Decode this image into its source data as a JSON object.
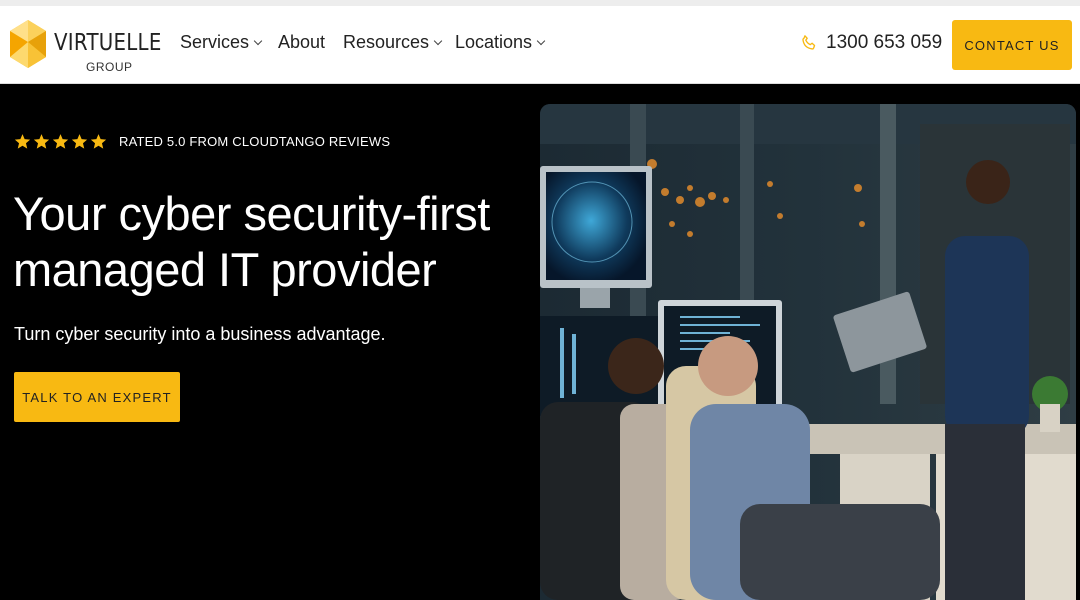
{
  "logo": {
    "name": "VIRTUELLE",
    "sub": "GROUP",
    "mark_color": "#f8b912"
  },
  "nav": {
    "items": [
      {
        "label": "Services",
        "dropdown": true
      },
      {
        "label": "About",
        "dropdown": false
      },
      {
        "label": "Resources",
        "dropdown": true
      },
      {
        "label": "Locations",
        "dropdown": true
      }
    ]
  },
  "header": {
    "phone": "1300 653 059",
    "contact_label": "CONTACT US"
  },
  "hero": {
    "rating_stars": 5,
    "rating_text": "RATED 5.0 FROM CLOUDTANGO REVIEWS",
    "headline_line1": "Your cyber security-first",
    "headline_line2": "managed IT provider",
    "subheadline": "Turn cyber security into a business advantage.",
    "cta_label": "TALK TO AN EXPERT"
  },
  "colors": {
    "accent": "#f8b912",
    "background": "#000000",
    "header_bg": "#ffffff"
  }
}
